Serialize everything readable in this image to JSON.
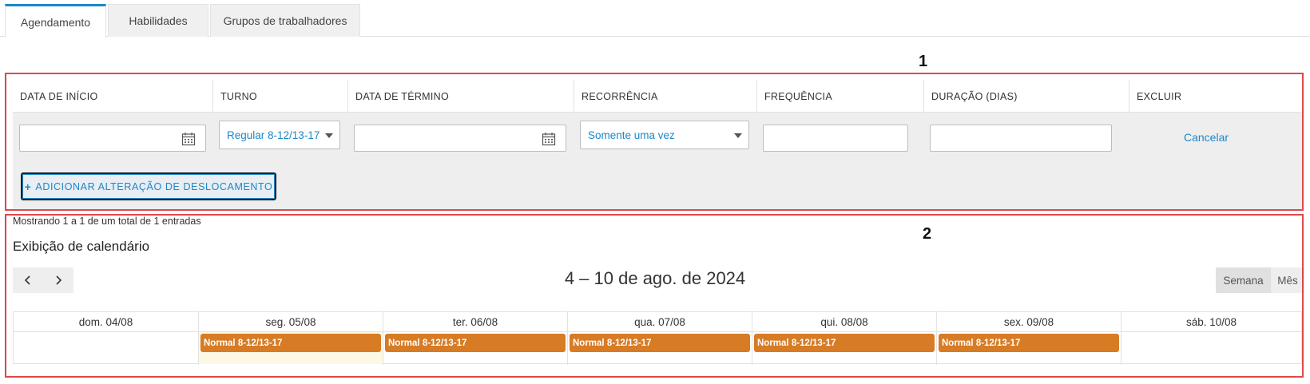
{
  "tabs": [
    {
      "label": "Agendamento"
    },
    {
      "label": "Habilidades"
    },
    {
      "label": "Grupos de trabalhadores"
    }
  ],
  "annotations": {
    "one": "1",
    "two": "2"
  },
  "form": {
    "headers": {
      "start_date": "DATA DE INÍCIO",
      "shift": "TURNO",
      "end_date": "DATA DE TÉRMINO",
      "recurrence": "RECORRÊNCIA",
      "frequency": "FREQUÊNCIA",
      "duration": "DURAÇÃO (DIAS)",
      "delete": "EXCLUIR"
    },
    "start_date_value": "",
    "shift_value": "Regular 8-12/13-17",
    "end_date_value": "",
    "recurrence_value": "Somente uma vez",
    "frequency_value": "",
    "duration_value": "",
    "cancel_label": "Cancelar",
    "add_button_label": "ADICIONAR ALTERAÇÃO DE DESLOCAMENTO"
  },
  "calendar": {
    "entries_info": "Mostrando 1 a 1 de um total de 1 entradas",
    "title": "Exibição de calendário",
    "range_title": "4 – 10 de ago. de 2024",
    "view_week": "Semana",
    "view_month": "Mês",
    "days": [
      {
        "label": "dom. 04/08",
        "event": ""
      },
      {
        "label": "seg. 05/08",
        "event": "Normal 8-12/13-17"
      },
      {
        "label": "ter. 06/08",
        "event": "Normal 8-12/13-17"
      },
      {
        "label": "qua. 07/08",
        "event": "Normal 8-12/13-17"
      },
      {
        "label": "qui. 08/08",
        "event": "Normal 8-12/13-17"
      },
      {
        "label": "sex. 09/08",
        "event": "Normal 8-12/13-17"
      },
      {
        "label": "sáb. 10/08",
        "event": ""
      }
    ],
    "colors": {
      "event": "#d77b25",
      "today": "#fcf8e3",
      "accent": "#1e87c8"
    }
  }
}
